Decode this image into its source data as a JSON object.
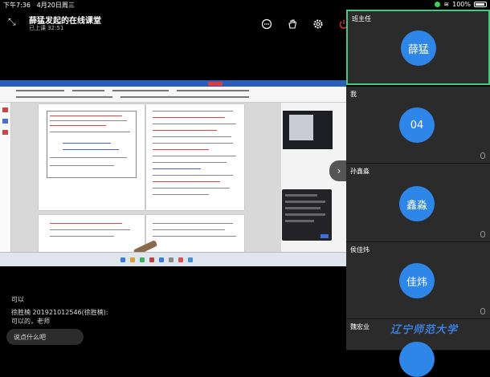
{
  "status": {
    "time": "下午7:36",
    "date": "4月20日周三",
    "battery": "100%"
  },
  "header": {
    "title": "薛猛发起的在线课堂",
    "subtitle": "已上课 32:51"
  },
  "chat": {
    "messages": [
      {
        "author": "",
        "text": "可以"
      },
      {
        "author": "徐胜楠 201921012546(徐胜楠):",
        "text": "可以的，老师"
      }
    ],
    "input_placeholder": "说点什么吧"
  },
  "participants": [
    {
      "label": "班主任",
      "avatar": "薛猛",
      "active": true
    },
    {
      "label": "我",
      "avatar": "04",
      "active": false
    },
    {
      "label": "孙鑫淼",
      "avatar": "鑫淼",
      "active": false
    },
    {
      "label": "侯佳炜",
      "avatar": "佳炜",
      "active": false
    },
    {
      "label": "魏宏业",
      "avatar": "",
      "active": false
    }
  ],
  "watermark": "辽宁师范大学",
  "colors": {
    "accent": "#2e86e8",
    "active_border": "#4fc47e",
    "end_call": "#e5352d"
  },
  "icons": [
    "collapse-icon",
    "chat-icon",
    "hand-icon",
    "settings-icon",
    "power-icon",
    "chevron-right-icon",
    "mic-icon"
  ]
}
